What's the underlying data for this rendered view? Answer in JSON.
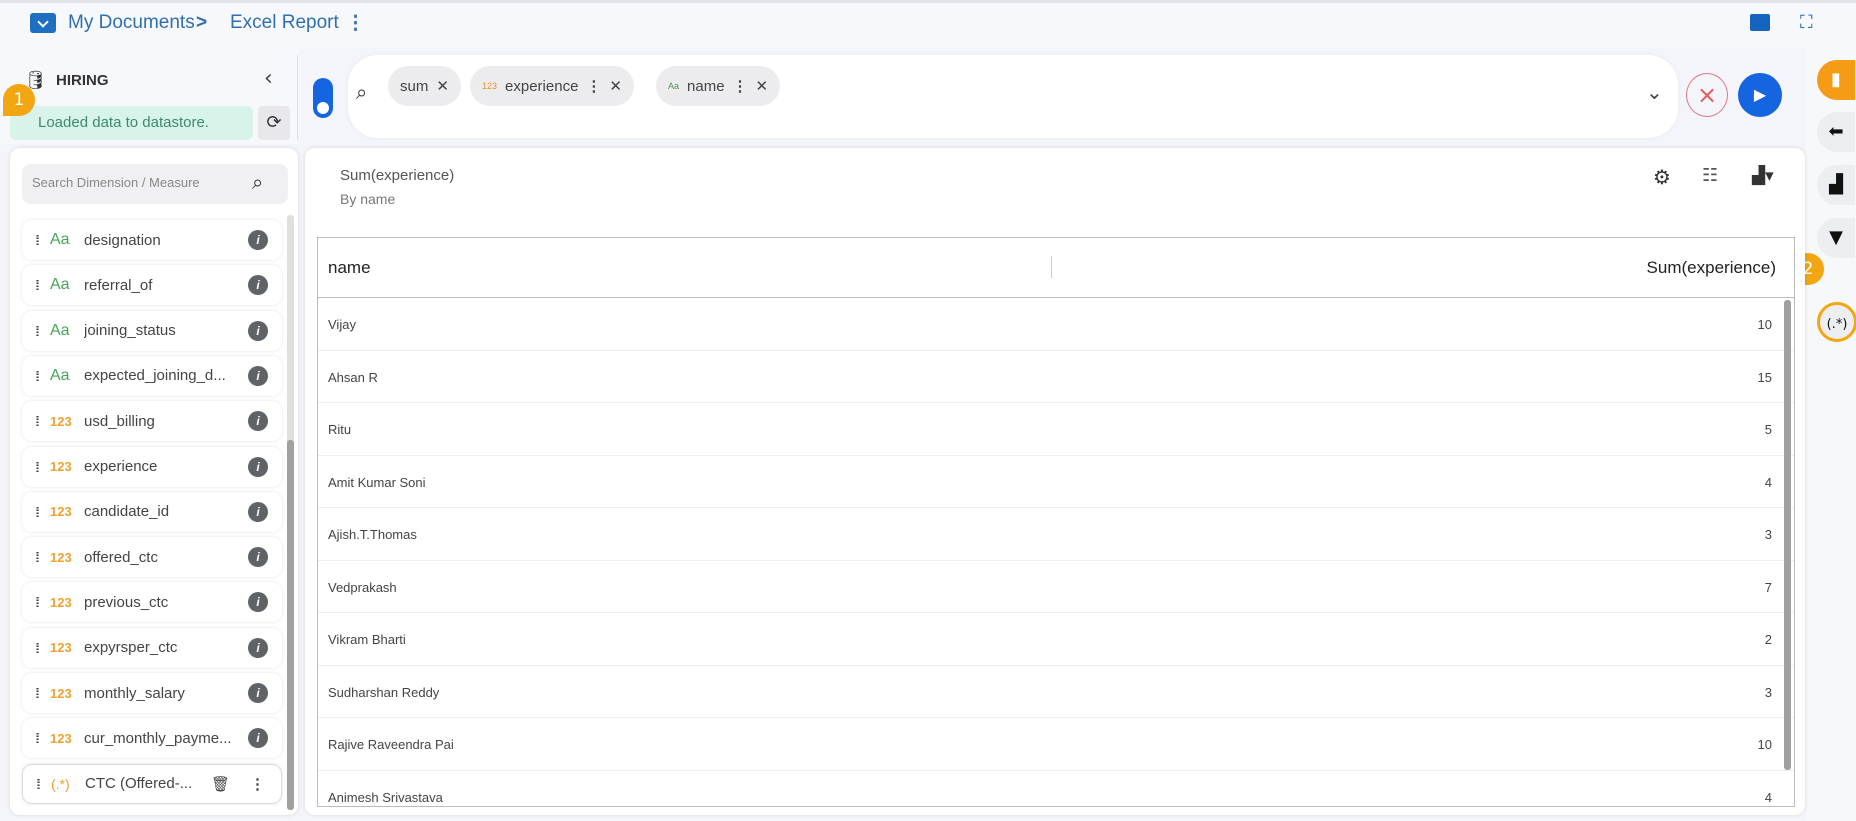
{
  "breadcrumb": {
    "root": "My Documents",
    "separator": ">",
    "current": "Excel Report"
  },
  "datasource": {
    "name": "HIRING",
    "status": "Loaded data to datastore."
  },
  "query": {
    "chips": [
      {
        "label": "sum",
        "type": ""
      },
      {
        "label": "experience",
        "type": "123"
      },
      {
        "label": "name",
        "type": "Aa"
      }
    ]
  },
  "sidebar": {
    "search_placeholder": "Search Dimension / Measure",
    "items": [
      {
        "type": "Aa",
        "label": "designation"
      },
      {
        "type": "Aa",
        "label": "referral_of"
      },
      {
        "type": "Aa",
        "label": "joining_status"
      },
      {
        "type": "Aa",
        "label": "expected_joining_d..."
      },
      {
        "type": "123",
        "label": "usd_billing"
      },
      {
        "type": "123",
        "label": "experience"
      },
      {
        "type": "123",
        "label": "candidate_id"
      },
      {
        "type": "123",
        "label": "offered_ctc"
      },
      {
        "type": "123",
        "label": "previous_ctc"
      },
      {
        "type": "123",
        "label": "expyrsper_ctc"
      },
      {
        "type": "123",
        "label": "monthly_salary"
      },
      {
        "type": "123",
        "label": "cur_monthly_payme..."
      }
    ],
    "custom": {
      "type": "(.*)",
      "label": "CTC (Offered-..."
    }
  },
  "report": {
    "title": "Sum(experience)",
    "subtitle": "By name",
    "columns": [
      "name",
      "Sum(experience)"
    ],
    "rows": [
      [
        "Vijay",
        "10"
      ],
      [
        "Ahsan R",
        "15"
      ],
      [
        "Ritu",
        "5"
      ],
      [
        "Amit Kumar Soni",
        "4"
      ],
      [
        "Ajish.T.Thomas",
        "3"
      ],
      [
        "Vedprakash",
        "7"
      ],
      [
        "Vikram Bharti",
        "2"
      ],
      [
        "Sudharshan Reddy",
        "3"
      ],
      [
        "Rajive Raveendra Pai",
        "10"
      ],
      [
        "Animesh Srivastava",
        "4"
      ]
    ]
  },
  "rail": {
    "regex_label": "(.*)"
  },
  "annotations": {
    "one": "1",
    "two": "2"
  }
}
